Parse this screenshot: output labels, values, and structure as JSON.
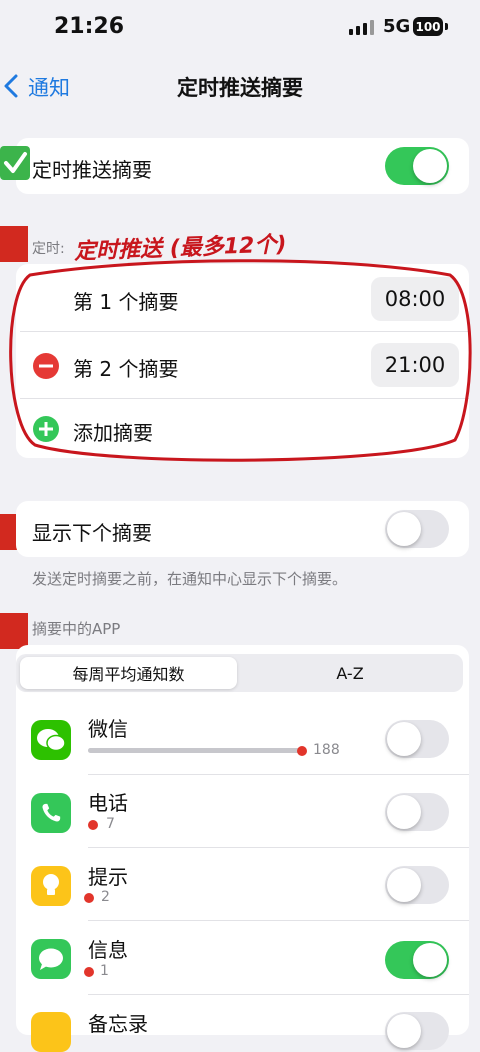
{
  "status_bar": {
    "time": "21:26",
    "network": "5G",
    "battery": "100"
  },
  "nav": {
    "back_label": "通知",
    "title": "定时推送摘要"
  },
  "main_toggle": {
    "label": "定时推送摘要",
    "on": true
  },
  "schedule": {
    "section_label": "定时:",
    "annotation": "定时推送 (最多12个)",
    "items": [
      {
        "label": "第 1 个摘要",
        "time": "08:00"
      },
      {
        "label": "第 2 个摘要",
        "time": "21:00"
      }
    ],
    "add_label": "添加摘要"
  },
  "next_summary": {
    "label": "显示下个摘要",
    "on": false,
    "footer": "发送定时摘要之前，在通知中心显示下个摘要。"
  },
  "apps_section": {
    "header": "摘要中的APP",
    "segments": [
      "每周平均通知数",
      "A-Z"
    ],
    "selected_segment": 0,
    "apps": [
      {
        "name": "微信",
        "count": "188",
        "level": 1.0,
        "on": false,
        "icon": "wechat-icon",
        "color": "#2dc100"
      },
      {
        "name": "电话",
        "count": "7",
        "level": 0.04,
        "on": false,
        "icon": "phone-icon",
        "color": "#34c759"
      },
      {
        "name": "提示",
        "count": "2",
        "level": 0.01,
        "on": false,
        "icon": "tips-icon",
        "color": "#fcc419"
      },
      {
        "name": "信息",
        "count": "1",
        "level": 0.005,
        "on": true,
        "icon": "messages-icon",
        "color": "#34c759"
      },
      {
        "name": "备忘录",
        "count": "",
        "level": 0,
        "on": false,
        "icon": "notes-icon",
        "color": "#fcc419"
      }
    ]
  },
  "colors": {
    "accent": "#1f7ae0",
    "toggle_on": "#34c759",
    "annotation_red": "#c8161d"
  }
}
